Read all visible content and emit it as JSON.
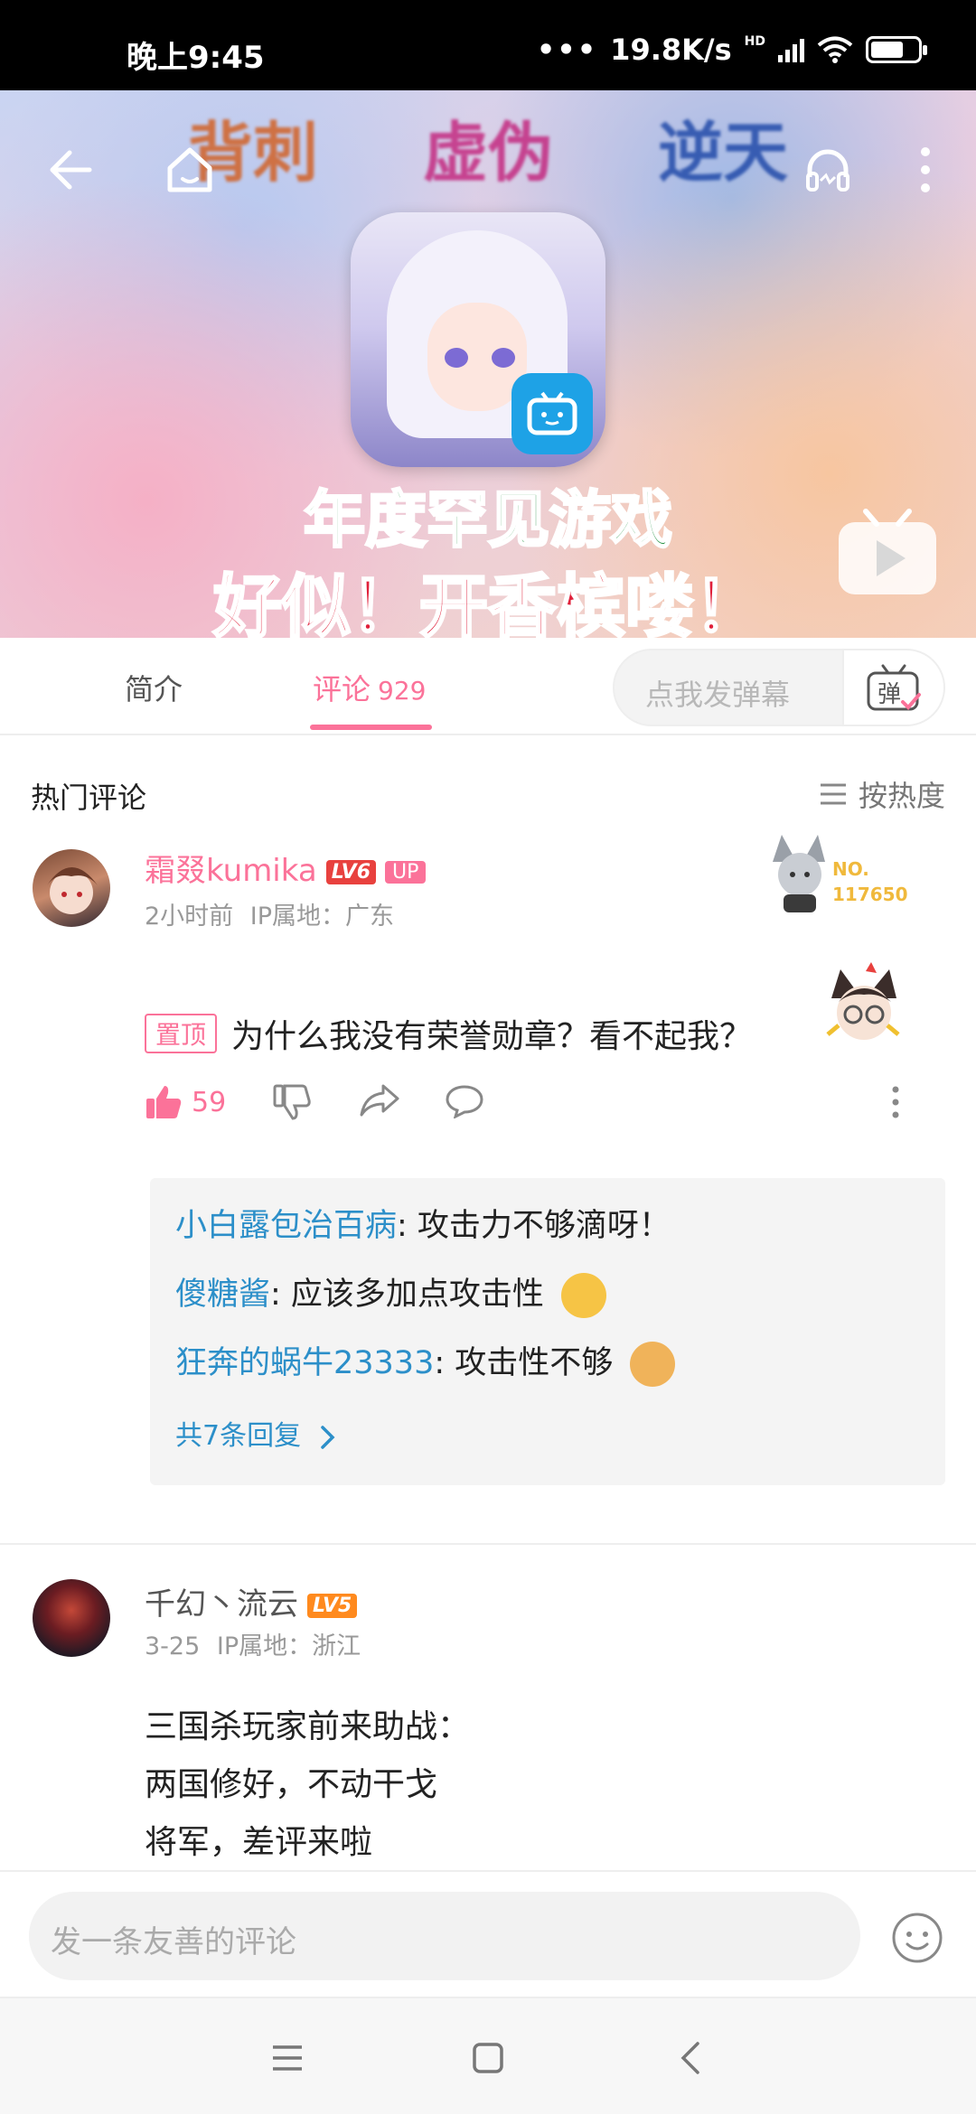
{
  "status_bar": {
    "time": "晚上9:45",
    "network_speed": "19.8K/s",
    "network_badge": "HD",
    "battery_level": 0.7
  },
  "banner": {
    "top_words": [
      "背刺",
      "虚伪",
      "逆天"
    ],
    "headline_line1": "年度罕见游戏",
    "headline_line2": "好似！开香槟喽！"
  },
  "tabs": {
    "intro_label": "简介",
    "comments_label": "评论",
    "comments_count": "929",
    "danmaku_placeholder": "点我发弹幕",
    "danmaku_button": "弹"
  },
  "hot_section": {
    "title": "热门评论",
    "sort_label": "按热度"
  },
  "comment1": {
    "username": "霜叕kumika",
    "level": "LV6",
    "up_badge": "UP",
    "time": "2小时前",
    "ip": "IP属地：广东",
    "badge_no_label": "NO.",
    "badge_no_value": "117650",
    "pin_label": "置顶",
    "text": "为什么我没有荣誉勋章？看不起我？",
    "likes": "59",
    "replies": [
      {
        "user": "小白露包治百病",
        "text": ": 攻击力不够滴呀！"
      },
      {
        "user": "傻糖酱",
        "text": ": 应该多加点攻击性"
      },
      {
        "user": "狂奔的蜗牛23333",
        "text": ": 攻击性不够"
      }
    ],
    "reply_more": "共7条回复"
  },
  "comment2": {
    "username": "千幻丶流云",
    "level": "LV5",
    "time": "3-25",
    "ip": "IP属地：浙江",
    "line1": "三国杀玩家前来助战：",
    "line2": "两国修好，不动干戈",
    "line3": "将军，差评来啦"
  },
  "input": {
    "placeholder": "发一条友善的评论"
  },
  "colors": {
    "accent": "#fb7299",
    "link": "#2c8fc9",
    "lv6": "#e8413e",
    "lv5": "#ff8a1e"
  }
}
